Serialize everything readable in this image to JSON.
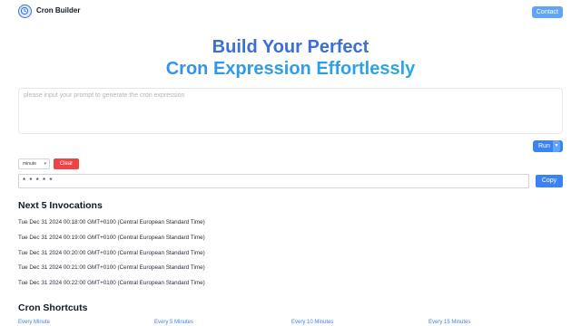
{
  "header": {
    "brand": "Cron Builder",
    "logo_icon": "clock-icon",
    "contact_label": "Contact"
  },
  "hero": {
    "line1": "Build Your Perfect",
    "line2": "Cron Expression Effortlessly"
  },
  "prompt": {
    "placeholder": "please input your prompt to generate the cron expression",
    "value": ""
  },
  "run_label": "Run",
  "unit_select": {
    "selected": "minute"
  },
  "clear_label": "Clear",
  "expression": "* * * * *",
  "copy_label": "Copy",
  "invocations": {
    "title": "Next 5 Invocations",
    "items": [
      "Tue Dec 31 2024 00:18:00 GMT+0100 (Central European Standard Time)",
      "Tue Dec 31 2024 00:19:00 GMT+0100 (Central European Standard Time)",
      "Tue Dec 31 2024 00:20:00 GMT+0100 (Central European Standard Time)",
      "Tue Dec 31 2024 00:21:00 GMT+0100 (Central European Standard Time)",
      "Tue Dec 31 2024 00:22:00 GMT+0100 (Central European Standard Time)"
    ]
  },
  "shortcuts": {
    "title": "Cron Shortcuts",
    "items": [
      "Every Minute",
      "Every 5 Minutes",
      "Every 10 Minutes",
      "Every 15 Minutes"
    ]
  },
  "colors": {
    "accent": "#3b82f6",
    "danger": "#ef4444",
    "title": "#3b6fd4"
  }
}
